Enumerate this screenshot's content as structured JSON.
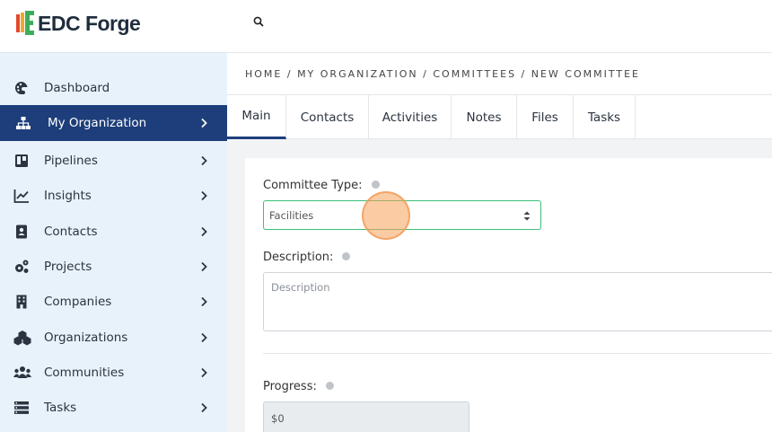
{
  "app": {
    "brand": "EDC Forge"
  },
  "colors": {
    "accent": "#1d3e7a",
    "sidebar_bg": "#e8f2fb",
    "focus": "#3dbf7a"
  },
  "sidebar": {
    "items": [
      {
        "label": "Dashboard",
        "icon": "palette-icon",
        "has_chevron": false
      },
      {
        "label": "My Organization",
        "icon": "org-chart-icon",
        "has_chevron": true,
        "active": true
      },
      {
        "label": "Pipelines",
        "icon": "board-icon",
        "has_chevron": true
      },
      {
        "label": "Insights",
        "icon": "chart-line-icon",
        "has_chevron": true
      },
      {
        "label": "Contacts",
        "icon": "contact-card-icon",
        "has_chevron": true
      },
      {
        "label": "Projects",
        "icon": "cogs-icon",
        "has_chevron": true
      },
      {
        "label": "Companies",
        "icon": "building-icon",
        "has_chevron": true
      },
      {
        "label": "Organizations",
        "icon": "cubes-icon",
        "has_chevron": true
      },
      {
        "label": "Communities",
        "icon": "users-icon",
        "has_chevron": true
      },
      {
        "label": "Tasks",
        "icon": "tasks-icon",
        "has_chevron": true
      }
    ]
  },
  "breadcrumb": "HOME / MY ORGANIZATION / COMMITTEES / NEW COMMITTEE",
  "tabs": [
    {
      "label": "Main",
      "active": true
    },
    {
      "label": "Contacts"
    },
    {
      "label": "Activities"
    },
    {
      "label": "Notes"
    },
    {
      "label": "Files"
    },
    {
      "label": "Tasks"
    }
  ],
  "form": {
    "committee_type": {
      "label": "Committee Type:",
      "value": "Facilities"
    },
    "description": {
      "label": "Description:",
      "placeholder": "Description"
    },
    "progress": {
      "label": "Progress:",
      "value": "$0"
    }
  }
}
